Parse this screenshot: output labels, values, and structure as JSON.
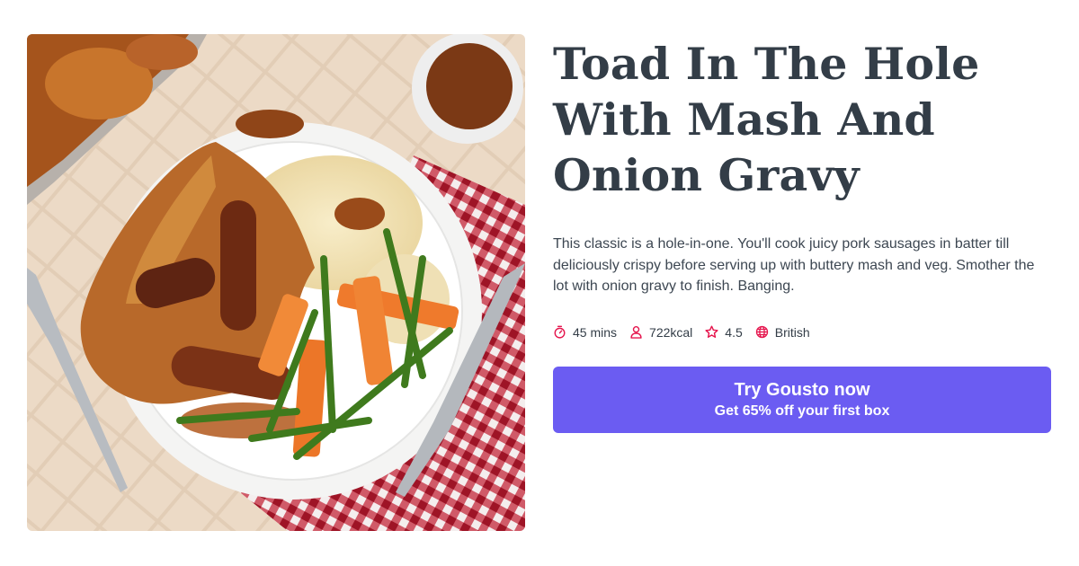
{
  "recipe": {
    "title": "Toad In The Hole With Mash And Onion Gravy",
    "description": "This classic is a hole-in-one. You'll cook juicy pork sausages in batter till deliciously crispy before serving up with buttery mash and veg. Smother the lot with onion gravy to finish. Banging.",
    "meta": [
      {
        "icon": "timer-icon",
        "text": "45 mins"
      },
      {
        "icon": "person-icon",
        "text": "722kcal"
      },
      {
        "icon": "star-icon",
        "text": "4.5"
      },
      {
        "icon": "globe-icon",
        "text": "British"
      }
    ]
  },
  "cta": {
    "main": "Try Gousto now",
    "sub": "Get 65% off your first box"
  },
  "colors": {
    "title": "#333d47",
    "icon_accent": "#e5154d",
    "cta_background": "#6b5cf2"
  }
}
